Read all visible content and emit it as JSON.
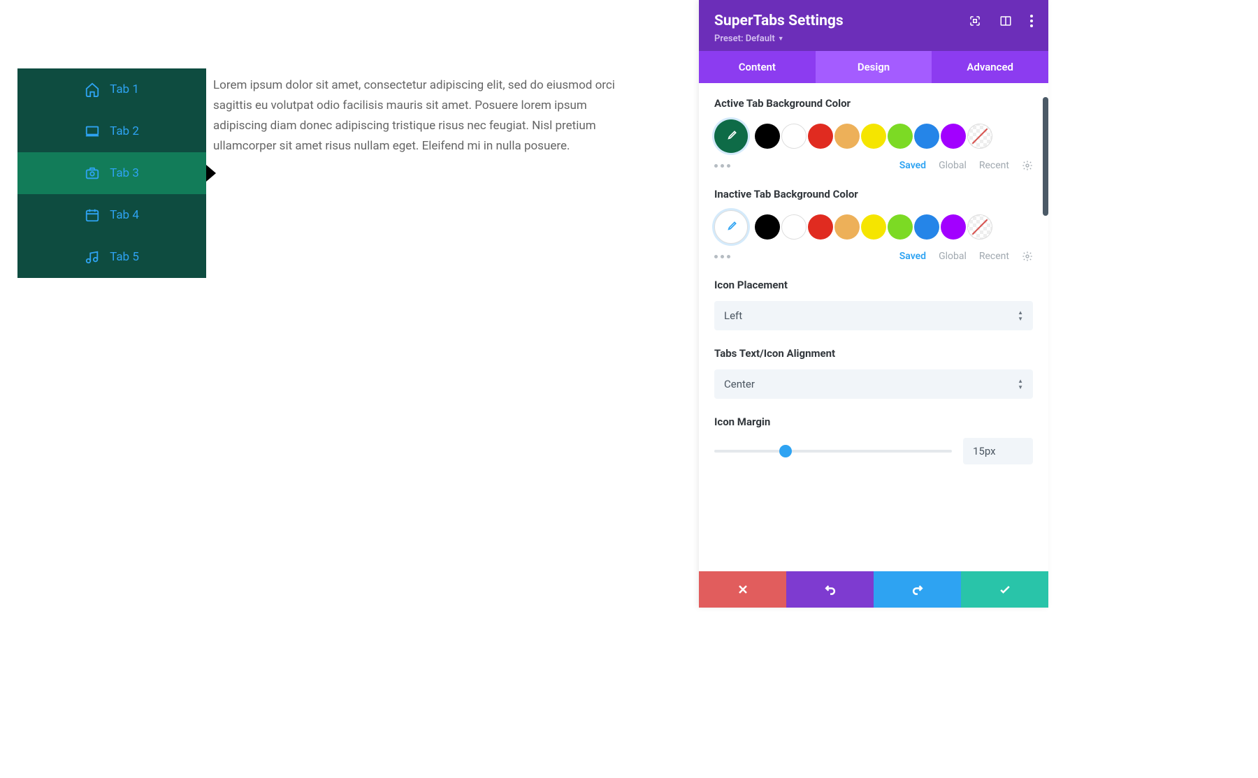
{
  "preview": {
    "tabs": [
      {
        "label": "Tab 1"
      },
      {
        "label": "Tab 2"
      },
      {
        "label": "Tab 3"
      },
      {
        "label": "Tab 4"
      },
      {
        "label": "Tab 5"
      }
    ],
    "active_index": 2,
    "content": "Lorem ipsum dolor sit amet, consectetur adipiscing elit, sed do eiusmod orci sagittis eu volutpat odio facilisis mauris sit amet. Posuere lorem ipsum adipiscing diam donec adipiscing tristique risus nec feugiat. Nisl pretium ullamcorper sit amet risus nullam eget. Eleifend mi in nulla posuere."
  },
  "panel": {
    "title": "SuperTabs Settings",
    "preset_label": "Preset: Default",
    "tabs": {
      "content": "Content",
      "design": "Design",
      "advanced": "Advanced"
    },
    "active_tab": "Design",
    "labels": {
      "active_bg": "Active Tab Background Color",
      "inactive_bg": "Inactive Tab Background Color",
      "icon_placement": "Icon Placement",
      "tabs_align": "Tabs Text/Icon Alignment",
      "icon_margin": "Icon Margin"
    },
    "color_tabs": {
      "saved": "Saved",
      "global": "Global",
      "recent": "Recent"
    },
    "swatch_colors": [
      "#000000",
      "#ffffff",
      "#e02b20",
      "#edb059",
      "#f5e500",
      "#7cda24",
      "#2585e8",
      "#a200ff"
    ],
    "active_picker_color": "#0e6b47",
    "inactive_picker_color": "#ffffff",
    "icon_placement_value": "Left",
    "tabs_align_value": "Center",
    "icon_margin_value": "15px",
    "icon_margin_percent": 30
  },
  "footer": {
    "buttons": [
      {
        "name": "cancel",
        "color": "#e15d5d"
      },
      {
        "name": "undo",
        "color": "#7e3bd0"
      },
      {
        "name": "redo",
        "color": "#2ea3f2"
      },
      {
        "name": "save",
        "color": "#29c4a9"
      }
    ]
  }
}
